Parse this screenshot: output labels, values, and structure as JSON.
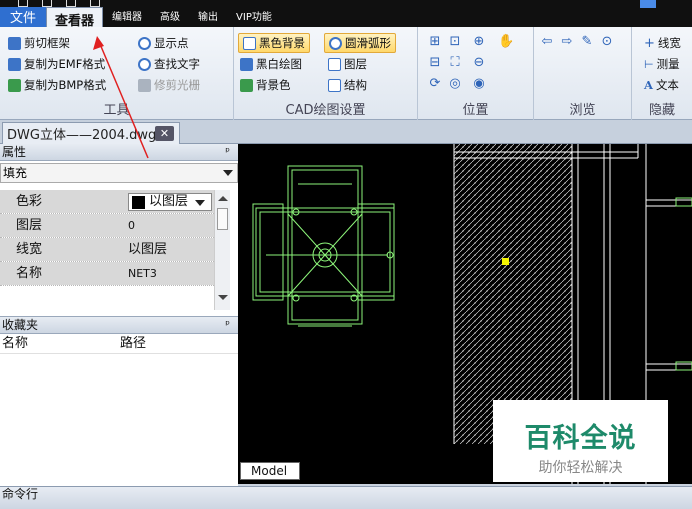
{
  "menubar": {
    "items": [
      "文件",
      "查看器",
      "编辑器",
      "高级",
      "输出",
      "VIP功能"
    ]
  },
  "ribbon": {
    "tools": {
      "title": "工具",
      "crop": "剪切框架",
      "copy_emf": "复制为EMF格式",
      "copy_bmp": "复制为BMP格式",
      "show_points": "显示点",
      "find_text": "查找文字",
      "trim_raster": "修剪光栅"
    },
    "cad_settings": {
      "title": "CAD绘图设置",
      "black_bg": "黑色背景",
      "bw_draw": "黑白绘图",
      "bg_color": "背景色",
      "smooth_arc": "圆滑弧形",
      "layers": "图层",
      "structure": "结构"
    },
    "position": {
      "title": "位置"
    },
    "browse": {
      "title": "浏览"
    },
    "hide": {
      "title": "隐藏",
      "line_width": "线宽",
      "measure": "测量",
      "text": "文本"
    }
  },
  "document_tab": {
    "title": "DWG立体——2004.dwg",
    "close_symbol": "✕"
  },
  "properties": {
    "header": "属性",
    "pin_symbol": "ᵖ",
    "category": "填充",
    "rows": [
      {
        "name": "色彩",
        "value": "以图层"
      },
      {
        "name": "图层",
        "value": "0"
      },
      {
        "name": "线宽",
        "value": "以图层"
      },
      {
        "name": "名称",
        "value": "NET3"
      }
    ]
  },
  "favorites": {
    "header": "收藏夹",
    "pin_symbol": "ᵖ",
    "col_name": "名称",
    "col_path": "路径"
  },
  "canvas": {
    "model_tab": "Model",
    "background": "#000000",
    "stroke_color": "#8df57a"
  },
  "watermark": {
    "title": "百科全说",
    "subtitle": "助你轻松解决"
  },
  "command_line": {
    "label": "命令行"
  }
}
